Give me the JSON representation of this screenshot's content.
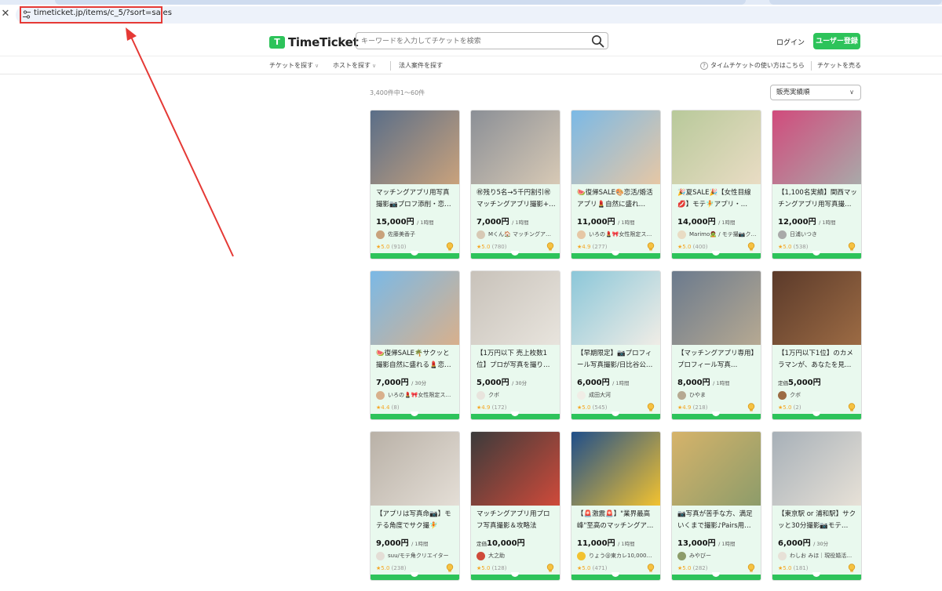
{
  "browser": {
    "url": "timeticket.jp/items/c_5/?sort=sales"
  },
  "header": {
    "logo_mark": "T",
    "logo_text": "TimeTicket",
    "search_placeholder": "キーワードを入力してチケットを検索",
    "login": "ログイン",
    "register": "ユーザー登録"
  },
  "subnav": {
    "find_ticket": "チケットを探す",
    "find_host": "ホストを探す",
    "corporate": "法人案件を探す",
    "help": "タイムチケットの使い方はこちら",
    "sell": "チケットを売る"
  },
  "results": {
    "count": "3,400件中1〜60件",
    "sort": "販売実績順"
  },
  "colors": {
    "brand": "#2dc35a",
    "annotation": "#e53935"
  },
  "cards": [
    {
      "title": "マッチングアプリ用写真撮影📷プロフ添削・恋…",
      "price": "15,000円",
      "unit": "/ 1時間",
      "teika": "",
      "host": "佐藤美香子",
      "rating": "5.0",
      "reviews": "(910)",
      "badge": true,
      "img": "#5a6e88",
      "img2": "#c9a27c"
    },
    {
      "title": "㊗残り5名→5千円割引㊗マッチングアプリ撮影+…",
      "price": "7,000円",
      "unit": "/ 1時間",
      "teika": "",
      "host": "Mくん🏠 マッチングア…",
      "rating": "5.0",
      "reviews": "(780)",
      "badge": true,
      "img": "#8b8f96",
      "img2": "#d7c9b5"
    },
    {
      "title": "🍉復帰SALE🎨恋活/婚活アプリ💄自然に盛れ…",
      "price": "11,000円",
      "unit": "/ 1時間",
      "teika": "",
      "host": "いろの💄🎀女性限定ス…",
      "rating": "4.9",
      "reviews": "(277)",
      "badge": true,
      "img": "#7bb9e6",
      "img2": "#e6c7a5"
    },
    {
      "title": "🎉夏SALE🎉【女性目線💋】モテ🧚アプリ・…",
      "price": "14,000円",
      "unit": "/ 1時間",
      "teika": "",
      "host": "Marimo🧟 / モテ撮📷ク…",
      "rating": "5.0",
      "reviews": "(400)",
      "badge": true,
      "img": "#b8c99a",
      "img2": "#e9dcc4"
    },
    {
      "title": "【1,100名実績】関西マッチングアプリ用写真撮…",
      "price": "12,000円",
      "unit": "/ 1時間",
      "teika": "",
      "host": "日浦いつき",
      "rating": "5.0",
      "reviews": "(538)",
      "badge": true,
      "img": "#d14b7c",
      "img2": "#a9a9a9"
    },
    {
      "title": "🍉復帰SALE🌴サクッと撮影自然に盛れる💄恋…",
      "price": "7,000円",
      "unit": "/ 30分",
      "teika": "",
      "host": "いろの💄🎀女性限定ス…",
      "rating": "4.4",
      "reviews": "(8)",
      "badge": false,
      "img": "#7bb9e6",
      "img2": "#d8b08c"
    },
    {
      "title": "【1万円以下 売上枚数1位】プロが写真を撮り…",
      "price": "5,000円",
      "unit": "/ 30分",
      "teika": "",
      "host": "クボ",
      "rating": "4.9",
      "reviews": "(172)",
      "badge": false,
      "img": "#c8c2ba",
      "img2": "#e8e4dd"
    },
    {
      "title": "【早期限定】📷プロフィール写真撮影/日比谷公…",
      "price": "6,000円",
      "unit": "/ 1時間",
      "teika": "",
      "host": "成田大河",
      "rating": "5.0",
      "reviews": "(545)",
      "badge": true,
      "img": "#8cc7d9",
      "img2": "#f0ede6"
    },
    {
      "title": "【マッチングアプリ専用】プロフィール写真…",
      "price": "8,000円",
      "unit": "/ 1時間",
      "teika": "",
      "host": "ひやま",
      "rating": "4.9",
      "reviews": "(218)",
      "badge": true,
      "img": "#6b7a8d",
      "img2": "#b6a992"
    },
    {
      "title": "【1万円以下1位】のカメラマンが、あなたを見…",
      "price": "5,000円",
      "unit": "",
      "teika": "定価",
      "host": "クボ",
      "rating": "5.0",
      "reviews": "(2)",
      "badge": true,
      "img": "#5b3a2a",
      "img2": "#9c6b44"
    },
    {
      "title": "【アプリは写真命📷】モテる角度でサク撮🧚",
      "price": "9,000円",
      "unit": "/ 1時間",
      "teika": "",
      "host": "suu/モテ角クリエイター",
      "rating": "5.0",
      "reviews": "(238)",
      "badge": true,
      "img": "#b9b1a7",
      "img2": "#e4ded6"
    },
    {
      "title": "マッチングアプリ用プロフ写真撮影＆攻略法",
      "price": "10,000円",
      "unit": "",
      "teika": "定価",
      "host": "大之助",
      "rating": "5.0",
      "reviews": "(128)",
      "badge": true,
      "img": "#3b3b3b",
      "img2": "#cf4a3a"
    },
    {
      "title": "【🚨激震🚨】\"業界最高峰\"至高のマッチングア…",
      "price": "11,000円",
      "unit": "/ 1時間",
      "teika": "",
      "host": "りょう@東カレ10,000…",
      "rating": "5.0",
      "reviews": "(471)",
      "badge": true,
      "img": "#1f4e8a",
      "img2": "#f2c230"
    },
    {
      "title": "📷写真が苦手な方、満足いくまで撮影♪Pairs用…",
      "price": "13,000円",
      "unit": "/ 1時間",
      "teika": "",
      "host": "みやびー",
      "rating": "5.0",
      "reviews": "(282)",
      "badge": true,
      "img": "#d6b36a",
      "img2": "#8d9c6a"
    },
    {
      "title": "【東京駅 or 浦和駅】サクッと30分撮影📷モテ…",
      "price": "6,000円",
      "unit": "/ 30分",
      "teika": "",
      "host": "わしお みほ｜現役婚活…",
      "rating": "5.0",
      "reviews": "(181)",
      "badge": true,
      "img": "#a7b0b8",
      "img2": "#e7e1d7"
    }
  ]
}
